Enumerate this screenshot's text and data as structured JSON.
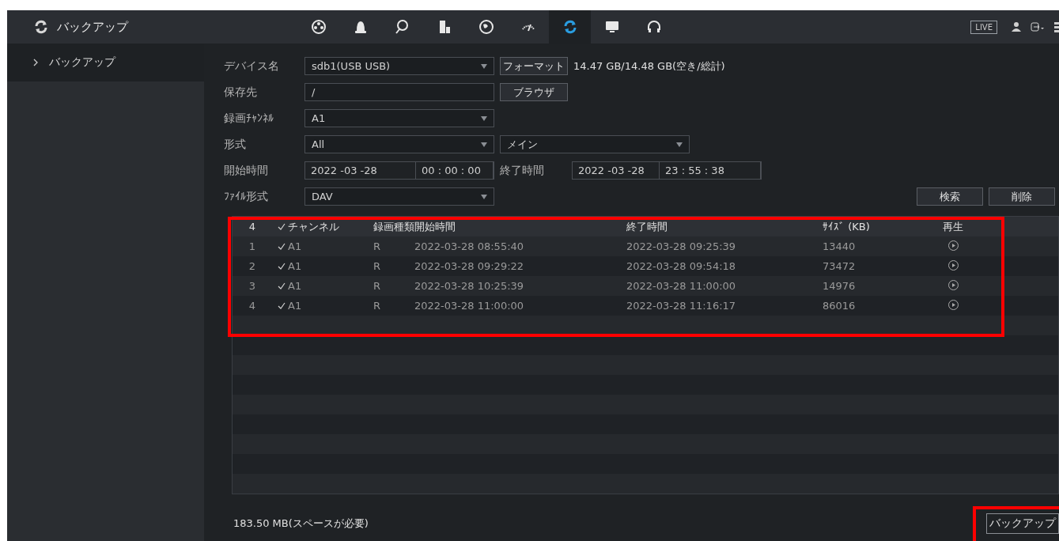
{
  "header": {
    "title": "バックアップ",
    "live_label": "LIVE",
    "nav": [
      {
        "kind": "reel",
        "selected": false
      },
      {
        "kind": "alarm",
        "selected": false
      },
      {
        "kind": "search",
        "selected": false
      },
      {
        "kind": "storage",
        "selected": false
      },
      {
        "kind": "network",
        "selected": false
      },
      {
        "kind": "gauge",
        "selected": false
      },
      {
        "kind": "sync",
        "selected": true
      },
      {
        "kind": "monitor",
        "selected": false
      },
      {
        "kind": "headset",
        "selected": false
      }
    ]
  },
  "sidebar": {
    "items": [
      {
        "label": "バックアップ",
        "selected": true
      }
    ]
  },
  "form": {
    "device": {
      "label": "デバイス名",
      "value": "sdb1(USB USB)",
      "button": "フォーマット",
      "capacity": "14.47 GB/14.48 GB(空き/総計)"
    },
    "destination": {
      "label": "保存先",
      "value": "/",
      "button": "ブラウザ"
    },
    "channel": {
      "label": "録画ﾁｬﾝﾈﾙ",
      "value": "A1"
    },
    "type": {
      "label": "形式",
      "value": "All",
      "stream": "メイン"
    },
    "time": {
      "start_label": "開始時間",
      "start_date": "2022 -03 -28",
      "start_time": "00 : 00 : 00",
      "end_label": "終了時間",
      "end_date": "2022 -03 -28",
      "end_time": "23 : 55 : 38"
    },
    "file_format": {
      "label": "ﾌｧｲﾙ形式",
      "value": "DAV"
    },
    "buttons": [
      "検索",
      "削除"
    ]
  },
  "table": {
    "count": "4",
    "all_checked": true,
    "columns": [
      "チャンネル",
      "録画種類",
      "開始時間",
      "終了時間",
      "ｻｲｽﾞ (KB)",
      "再生"
    ],
    "rows": [
      {
        "index": "1",
        "checked": true,
        "channel": "A1",
        "type": "R",
        "start": "2022-03-28 08:55:40",
        "end": "2022-03-28 09:25:39",
        "size": "13440"
      },
      {
        "index": "2",
        "checked": true,
        "channel": "A1",
        "type": "R",
        "start": "2022-03-28 09:29:22",
        "end": "2022-03-28 09:54:18",
        "size": "73472"
      },
      {
        "index": "3",
        "checked": true,
        "channel": "A1",
        "type": "R",
        "start": "2022-03-28 10:25:39",
        "end": "2022-03-28 11:00:00",
        "size": "14976"
      },
      {
        "index": "4",
        "checked": true,
        "channel": "A1",
        "type": "R",
        "start": "2022-03-28 11:00:00",
        "end": "2022-03-28 11:16:17",
        "size": "86016"
      }
    ]
  },
  "footer": {
    "required": "183.50 MB(スペースが必要)",
    "backup_button": "バックアップ"
  }
}
